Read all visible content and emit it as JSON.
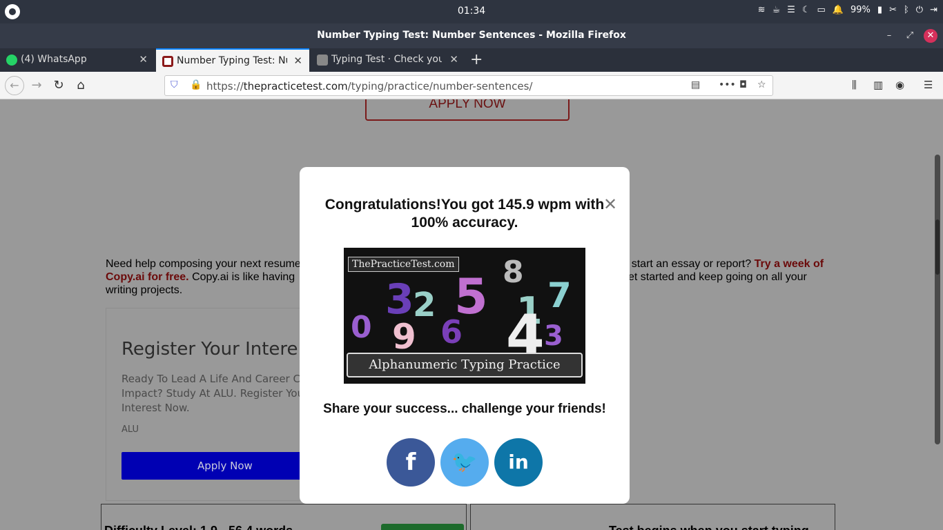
{
  "system": {
    "clock": "01:34",
    "battery": "99%"
  },
  "window": {
    "title": "Number Typing Test: Number Sentences - Mozilla Firefox"
  },
  "tabs": [
    {
      "label": "(4) WhatsApp",
      "icon": "whatsapp-icon"
    },
    {
      "label": "Number Typing Test: Nu",
      "icon": "practicetest-icon"
    },
    {
      "label": "Typing Test · Check your",
      "icon": "keyboard-icon"
    }
  ],
  "navbar": {
    "url_prefix": "https://",
    "url_host": "thepracticetest.com",
    "url_path": "/typing/practice/number-sentences/"
  },
  "page": {
    "apply_top": "APPLY NOW",
    "promo_start": "Need help composing your next resume",
    "promo_mid": "start an essay or report?",
    "promo_link": "Try a week of Copy.ai for free.",
    "promo_copy": "Copy.ai is like having",
    "promo_end": "get started and keep going on all your writing projects.",
    "ad": {
      "heading": "Register Your Intere",
      "body": "Ready To Lead A Life And Career C Impact? Study At ALU. Register You Interest Now.",
      "source": "ALU",
      "button": "Apply Now"
    },
    "difficulty": "Difficulty Level: 1.9 - 56.4 words",
    "test_begins": "Test begins when you start typing"
  },
  "modal": {
    "message": "Congratulations!You got 145.9 wpm with 100% accuracy.",
    "image_brand": "ThePracticeTest.com",
    "image_caption": "Alphanumeric Typing Practice",
    "share": "Share your success... challenge your friends!",
    "facebook": "f",
    "twitter": "🐦",
    "linkedin": "in"
  },
  "colors": {
    "facebook": "#3b5898",
    "twitter": "#55acee",
    "linkedin": "#0e76a8",
    "ad_button": "#0000b3",
    "promo_link": "#6b0a0a"
  }
}
